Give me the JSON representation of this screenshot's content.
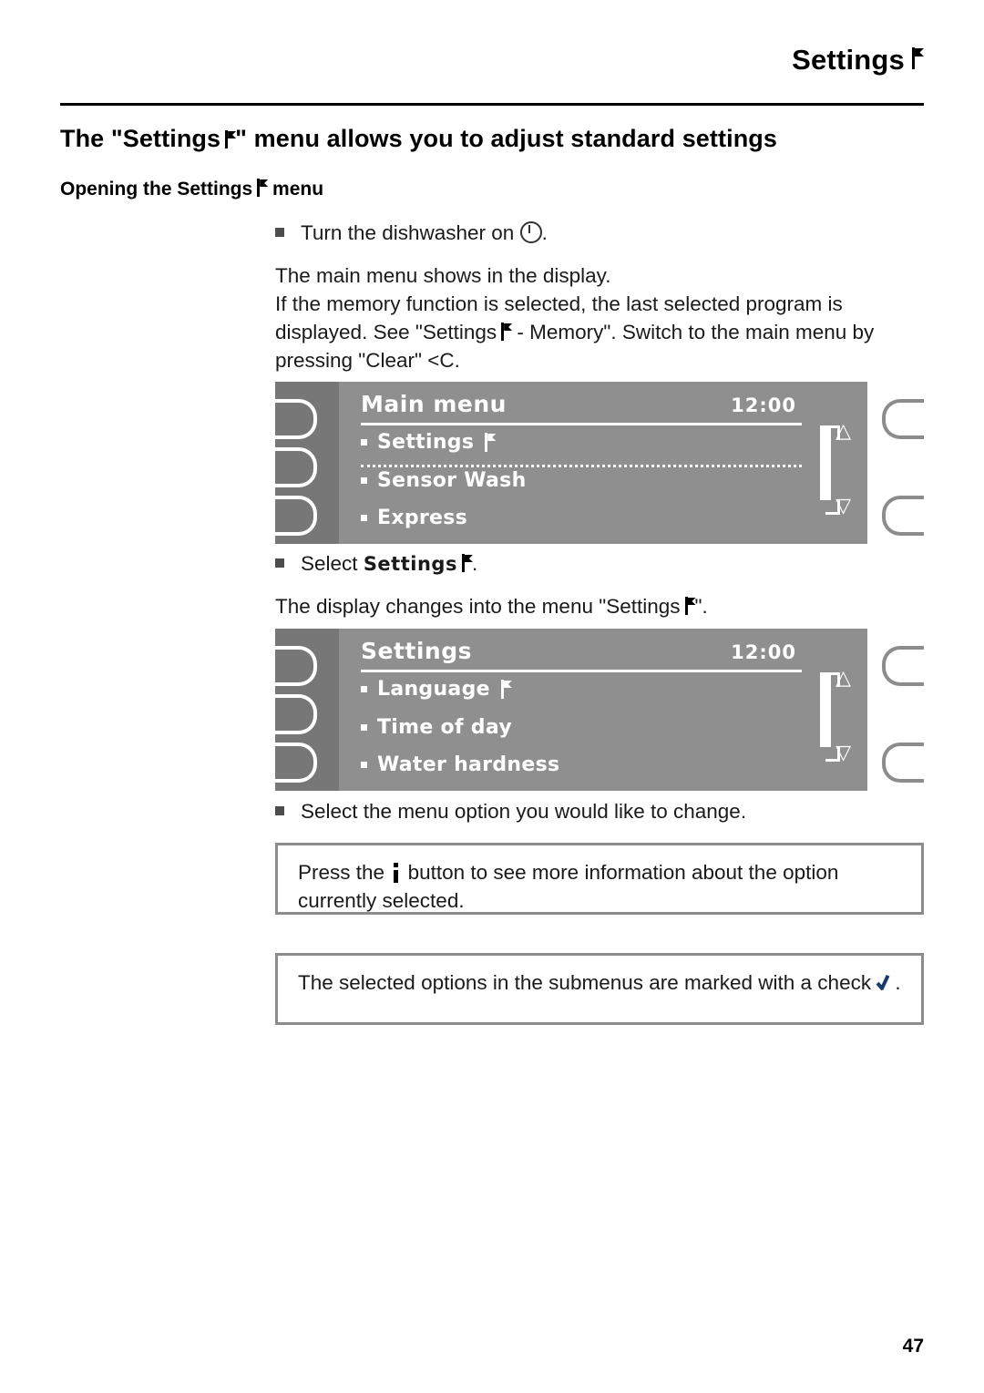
{
  "header": {
    "title": "Settings",
    "icon": "flag-icon"
  },
  "chapter": {
    "title_before": "The \"Settings",
    "title_after": "\" menu allows you to adjust standard settings",
    "section_before": "Opening the Settings",
    "section_after": "menu"
  },
  "steps": {
    "step1": "Turn the dishwasher on",
    "step1_end": ".",
    "para1": "The main menu shows in the display.",
    "para2_a": "If the memory function is selected, the last selected program is displayed. See \"Settings",
    "para2_b": "- Memory\". Switch to the main menu by pressing \"Clear\" <C.",
    "step2_label": "Select",
    "step2_value": "Settings",
    "step2_end": ".",
    "para3_a": "The display changes into the menu \"Settings",
    "para3_b": "\".",
    "step3": "Select the menu option you would like to change."
  },
  "display_main": {
    "title": "Main menu",
    "time": "12:00",
    "items": [
      "Settings",
      "Sensor Wash",
      "Express"
    ]
  },
  "display_settings": {
    "title": "Settings",
    "time": "12:00",
    "items": [
      "Language",
      "Time of day",
      "Water hardness"
    ]
  },
  "notes": {
    "note1_a": "Press the",
    "note1_b": "button to see more information about the option currently selected.",
    "note2_a": "The selected options in the submenus are marked with a check",
    "note2_b": "."
  },
  "footer": {
    "page": "47"
  }
}
